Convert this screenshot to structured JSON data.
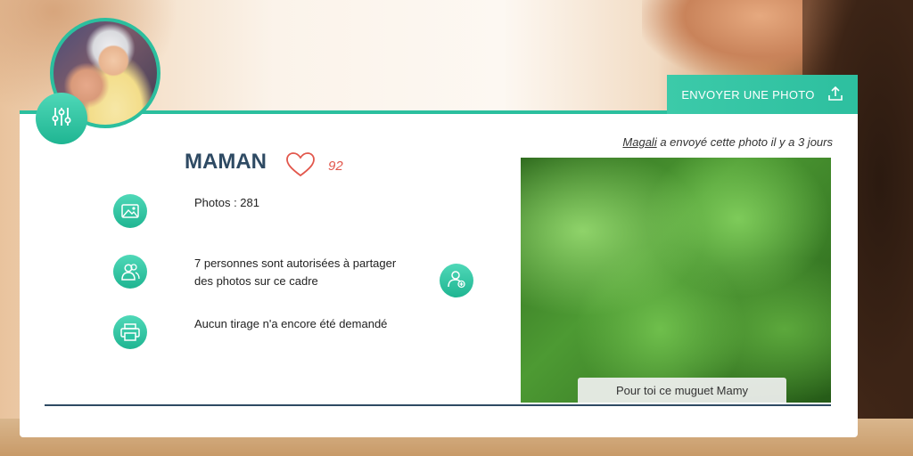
{
  "frame": {
    "name": "MAMAN",
    "likes": "92",
    "send_button_label": "ENVOYER UNE PHOTO",
    "sender_name": "Magali",
    "sender_suffix": " a envoyé cette photo il y a 3 jours",
    "stats": {
      "photos": "Photos : 281",
      "shared_line1": "7 personnes sont autorisées à partager",
      "shared_line2": "des photos sur ce cadre",
      "prints": "Aucun tirage n'a encore été demandé"
    },
    "photo_caption": "Pour toi ce muguet Mamy"
  },
  "icons": {
    "settings": "sliders-icon",
    "upload": "upload-icon",
    "heart": "heart-icon",
    "photos": "image-icon",
    "users": "users-icon",
    "add_user": "add-user-icon",
    "printer": "printer-icon"
  },
  "colors": {
    "accent": "#2bbf9e",
    "title": "#2e4a63",
    "heart": "#e2574c"
  }
}
